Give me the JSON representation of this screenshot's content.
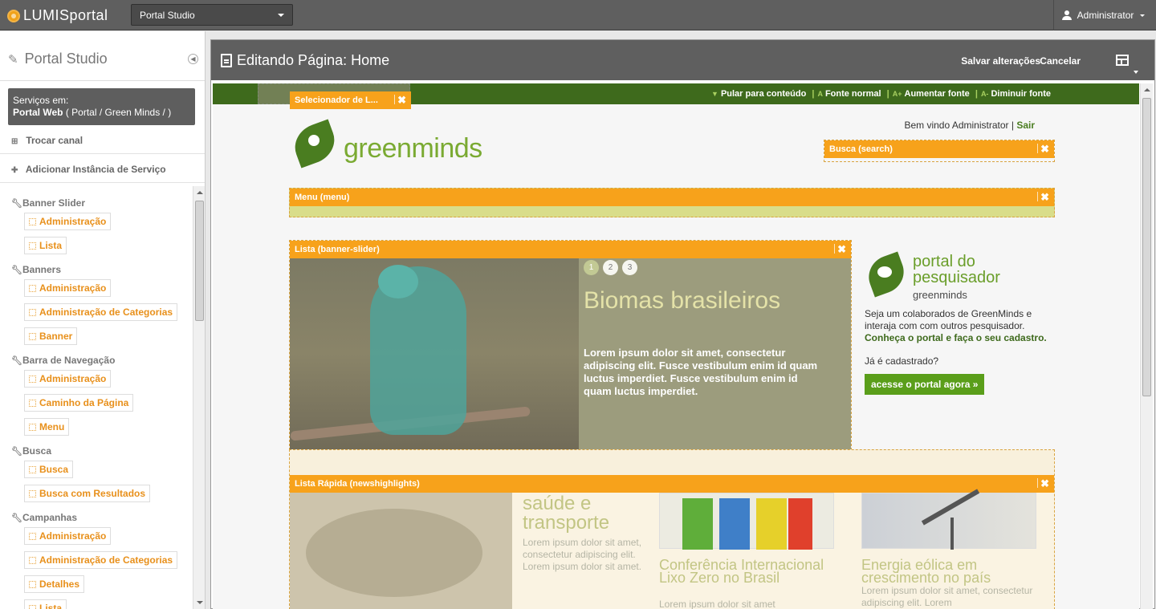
{
  "topbar": {
    "logo_text": "LUMISportal",
    "portal_select": "Portal Studio",
    "user": "Administrator"
  },
  "sidebar": {
    "title": "Portal Studio",
    "services_label": "Serviços em:",
    "services_portal": "Portal Web",
    "services_path": "( Portal / Green Minds / )",
    "trocar_canal": "Trocar canal",
    "adicionar": "Adicionar Instância de Serviço",
    "groups": [
      {
        "name": "Banner Slider",
        "items": [
          "Administração",
          "Lista"
        ]
      },
      {
        "name": "Banners",
        "items": [
          "Administração",
          "Administração de Categorias",
          "Banner"
        ]
      },
      {
        "name": "Barra de Navegação",
        "items": [
          "Administração",
          "Caminho da Página",
          "Menu"
        ]
      },
      {
        "name": "Busca",
        "items": [
          "Busca",
          "Busca com Resultados"
        ]
      },
      {
        "name": "Campanhas",
        "items": [
          "Administração",
          "Administração de Categorias",
          "Detalhes",
          "Lista"
        ]
      }
    ]
  },
  "editor": {
    "title": "Editando Página: Home",
    "save": "Salvar alterações",
    "cancel": "Cancelar"
  },
  "access_bar": {
    "skip": "Pular para conteúdo",
    "font_normal": "Fonte normal",
    "font_up": "Aumentar fonte",
    "font_down": "Diminuir fonte",
    "sep": "|"
  },
  "modules": {
    "selecionador": "Selecionador de L...",
    "busca": "Busca (search)",
    "menu": "Menu (menu)",
    "banner": "Lista (banner-slider)",
    "news": "Lista Rápida (newshighlights)"
  },
  "site": {
    "logo_word": "greenminds",
    "welcome": "Bem vindo Administrator |",
    "sair": "Sair",
    "slider_dots": [
      "1",
      "2",
      "3"
    ],
    "slider_headline": "Biomas brasileiros",
    "slider_body": "Lorem ipsum dolor sit amet, consectetur adipiscing elit. Fusce vestibulum enim id quam luctus imperdiet. Fusce vestibulum enim id quam luctus imperdiet.",
    "pesq_line1": "portal do",
    "pesq_line2": "pesquisador",
    "pesq_brand": "greenminds",
    "pesq_text": "Seja um colaborados de GreenMinds e interaja com com outros pesquisador.",
    "pesq_strong": "Conheça o portal e faça o seu cadastro.",
    "pesq_question": "Já é cadastrado?",
    "pesq_button": "acesse o portal agora »",
    "news1_title": "saúde e transporte",
    "news1_body": "Lorem ipsum dolor sit amet, consectetur adipiscing elit. Lorem ipsum dolor sit amet.",
    "news2_title": "Conferência Internacional Lixo Zero no Brasil",
    "news2_body": "Lorem ipsum dolor sit amet",
    "news3_title": "Energia eólica em crescimento no país",
    "news3_body": "Lorem ipsum dolor sit amet, consectetur adipiscing elit. Lorem"
  },
  "colors": {
    "accent_orange": "#f7a21b",
    "brand_green": "#3e6a1c",
    "light_green": "#7aaa32"
  }
}
